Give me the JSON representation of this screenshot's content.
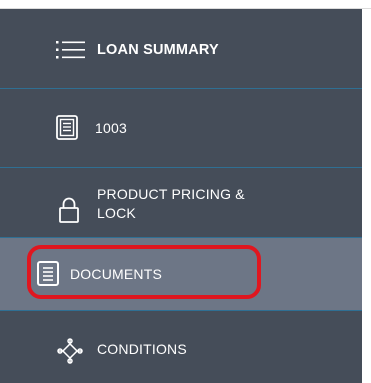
{
  "nav": {
    "items": [
      {
        "label": "LOAN SUMMARY",
        "icon": "list-icon",
        "active": false
      },
      {
        "label": "1003",
        "icon": "form-icon",
        "active": false
      },
      {
        "label": "PRODUCT PRICING &",
        "label2": "LOCK",
        "icon": "lock-icon",
        "active": false
      },
      {
        "label": "DOCUMENTS",
        "icon": "document-icon",
        "active": true
      },
      {
        "label": "CONDITIONS",
        "icon": "conditions-icon",
        "active": false
      }
    ]
  },
  "colors": {
    "sidebar_bg": "#454d59",
    "active_bg": "#6d7686",
    "divider": "#2f6f93",
    "highlight": "#e0161f"
  }
}
